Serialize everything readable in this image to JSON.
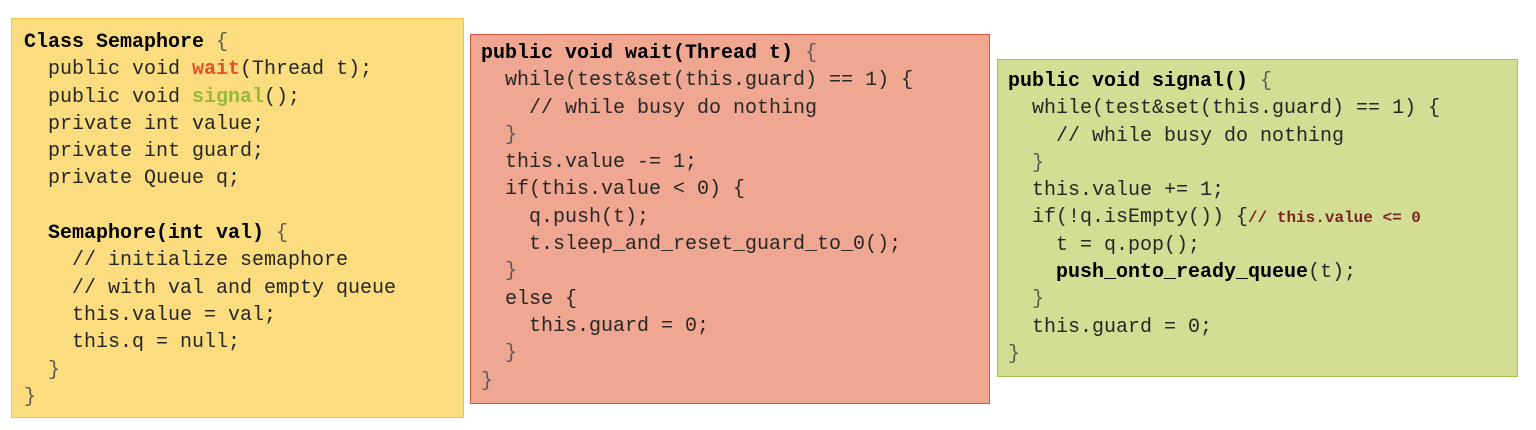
{
  "semaphore_class": {
    "l1_kw": "Class Semaphore",
    "l1_br": " {",
    "l2_a": "  public void ",
    "l2_wait": "wait",
    "l2_b": "(Thread t);",
    "l3_a": "  public void ",
    "l3_signal": "signal",
    "l3_b": "();",
    "l4": "  private int value;",
    "l5": "  private int guard;",
    "l6": "  private Queue q;",
    "l7": "",
    "l8_kw": "  Semaphore(int val)",
    "l8_br": " {",
    "l9": "    // initialize semaphore",
    "l10": "    // with val and empty queue",
    "l11": "    this.value = val;",
    "l12": "    this.q = null;",
    "l13": "  }",
    "l14": "}"
  },
  "wait_method": {
    "l1_kw": "public void wait(Thread t)",
    "l1_br": " {",
    "l2": "  while(test&set(this.guard) == 1) {",
    "l3": "    // while busy do nothing",
    "l4": "  }",
    "l5": "  this.value -= 1;",
    "l6": "  if(this.value < 0) {",
    "l7": "    q.push(t);",
    "l8": "    t.sleep_and_reset_guard_to_0();",
    "l9": "  }",
    "l10": "  else {",
    "l11": "    this.guard = 0;",
    "l12": "  }",
    "l13": "}"
  },
  "signal_method": {
    "l1_kw": "public void signal()",
    "l1_br": " {",
    "l2": "  while(test&set(this.guard) == 1) {",
    "l3": "    // while busy do nothing",
    "l4": "  }",
    "l5": "  this.value += 1;",
    "l6_a": "  if(!q.isEmpty()) {",
    "l6_cmt": "// this.value <= 0",
    "l7": "    t = q.pop();",
    "l8_pre": "    ",
    "l8_kw": "push_onto_ready_queue",
    "l8_post": "(t);",
    "l9": "  }",
    "l10": "  this.guard = 0;",
    "l11": "}"
  },
  "colors": {
    "class_bg": "#fbdd80",
    "wait_bg": "#efa792",
    "signal_bg": "#d3dd93",
    "wait_highlight": "#e84f2b",
    "signal_highlight": "#97b93a",
    "comment_bold": "#7a2424"
  }
}
